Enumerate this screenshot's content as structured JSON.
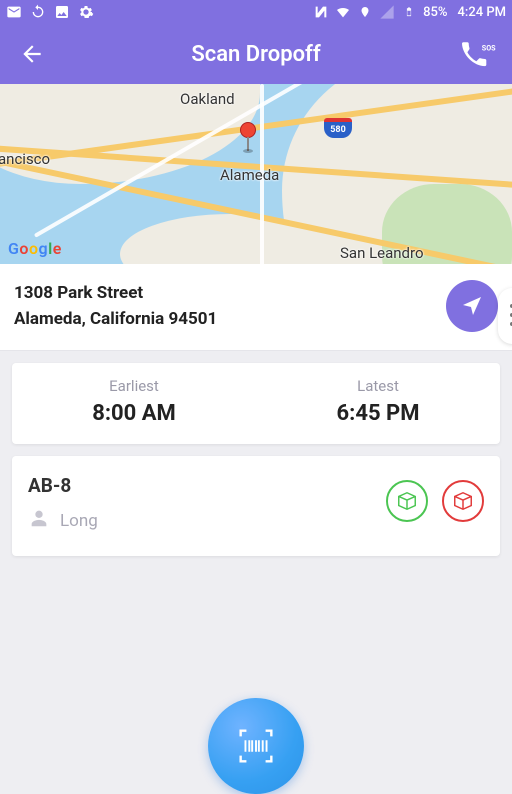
{
  "status": {
    "battery": "85%",
    "time": "4:24 PM"
  },
  "header": {
    "title": "Scan Dropoff"
  },
  "map": {
    "cities": {
      "oakland": "Oakland",
      "alameda": "Alameda",
      "sanfrancisco": "ancisco",
      "sanleandro": "San Leandro"
    },
    "shield": "580",
    "attribution": "Google"
  },
  "address": {
    "line1": "1308 Park Street",
    "line2": "Alameda, California 94501"
  },
  "timewindow": {
    "earliest_label": "Earliest",
    "earliest": "8:00 AM",
    "latest_label": "Latest",
    "latest": "6:45 PM"
  },
  "package": {
    "code": "AB-8",
    "recipient": "Long"
  }
}
